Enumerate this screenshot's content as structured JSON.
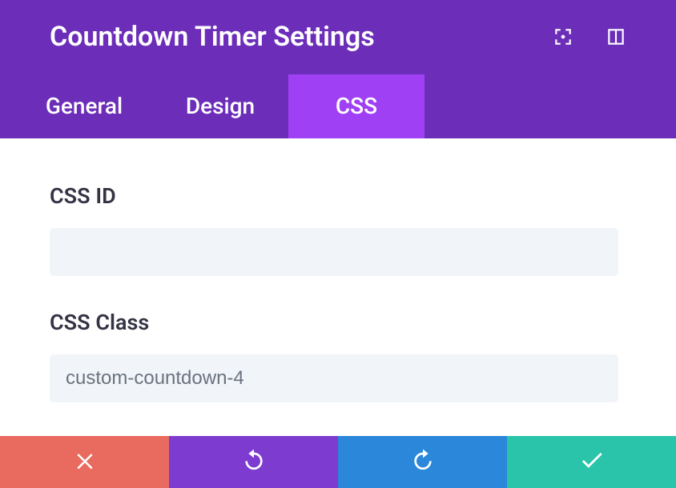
{
  "header": {
    "title": "Countdown Timer Settings"
  },
  "tabs": [
    {
      "label": "General",
      "active": false
    },
    {
      "label": "Design",
      "active": false
    },
    {
      "label": "CSS",
      "active": true
    }
  ],
  "fields": {
    "css_id": {
      "label": "CSS ID",
      "value": ""
    },
    "css_class": {
      "label": "CSS Class",
      "value": "custom-countdown-4"
    }
  },
  "footer": {
    "close": "close",
    "undo": "undo",
    "redo": "redo",
    "save": "save"
  },
  "colors": {
    "header_bg": "#6c2eb9",
    "tab_active_bg": "#a040f5",
    "input_bg": "#f1f5f9",
    "btn_close": "#e96a5f",
    "btn_undo": "#7e3bd0",
    "btn_redo": "#2b87da",
    "btn_save": "#29c4a9"
  }
}
